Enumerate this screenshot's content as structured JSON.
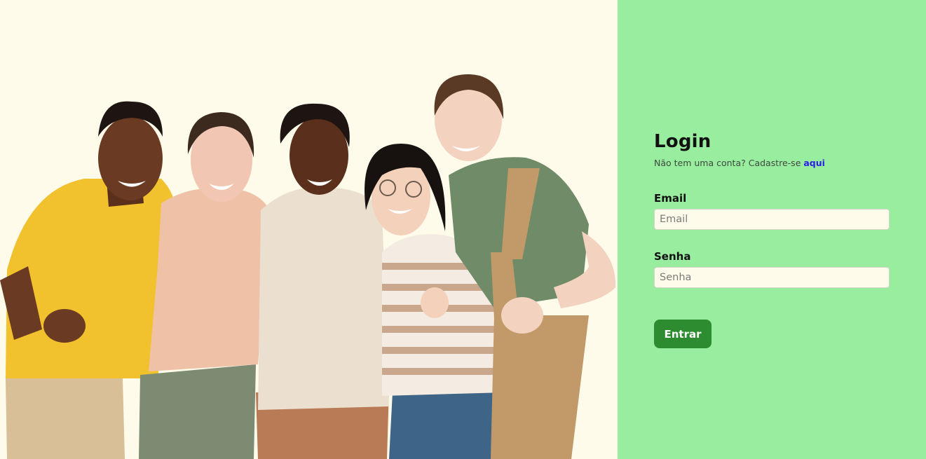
{
  "hero": {
    "image_description_icon": "group-photo"
  },
  "login": {
    "title": "Login",
    "signup_prompt": "Não tem uma conta? Cadastre-se",
    "signup_link": "aqui",
    "email_label": "Email",
    "email_placeholder": "Email",
    "email_value": "",
    "password_label": "Senha",
    "password_placeholder": "Senha",
    "password_value": "",
    "submit_label": "Entrar"
  },
  "colors": {
    "hero_background": "#fefbeb",
    "panel_background": "#98ed9e",
    "link": "#2c1ee6",
    "button": "#2c8c2f"
  }
}
